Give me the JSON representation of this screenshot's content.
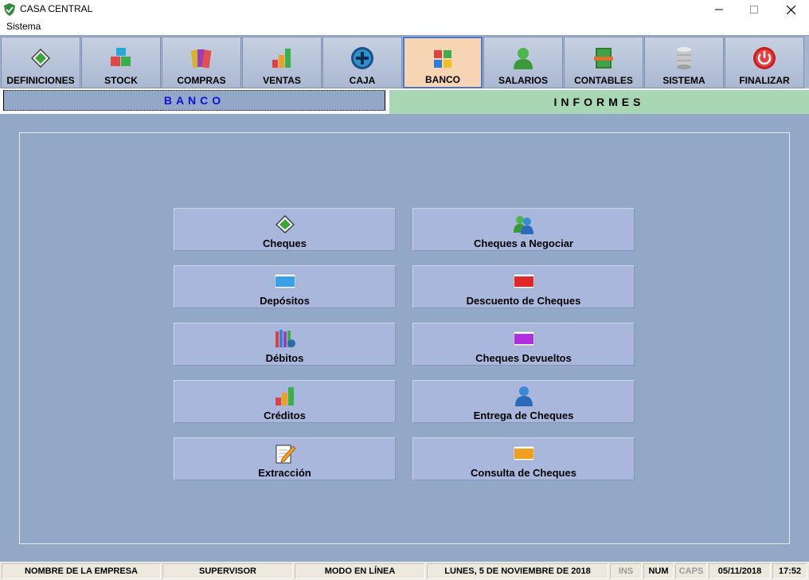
{
  "window": {
    "title": "CASA CENTRAL",
    "controls": {
      "minimize": "—",
      "maximize": "☐",
      "close": "✕"
    }
  },
  "menu": {
    "items": [
      "Sistema"
    ]
  },
  "toolbar": {
    "buttons": [
      {
        "label": "DEFINICIONES",
        "icon": "book-icon"
      },
      {
        "label": "STOCK",
        "icon": "boxes-icon"
      },
      {
        "label": "COMPRAS",
        "icon": "folders-icon"
      },
      {
        "label": "VENTAS",
        "icon": "bar-chart-icon"
      },
      {
        "label": "CAJA",
        "icon": "plus-circle-icon"
      },
      {
        "label": "BANCO",
        "icon": "windows-tiles-icon",
        "active": true
      },
      {
        "label": "SALARIOS",
        "icon": "user-icon"
      },
      {
        "label": "CONTABLES",
        "icon": "ledger-icon"
      },
      {
        "label": "SISTEMA",
        "icon": "database-icon"
      },
      {
        "label": "FINALIZAR",
        "icon": "power-icon"
      }
    ]
  },
  "tabs": {
    "banco": "BANCO",
    "informes": "INFORMES"
  },
  "functions": {
    "left": [
      {
        "label": "Cheques",
        "icon": "book-icon"
      },
      {
        "label": "Depósitos",
        "icon": "blue-card-icon"
      },
      {
        "label": "Débitos",
        "icon": "books-icon"
      },
      {
        "label": "Créditos",
        "icon": "bar-chart-icon"
      },
      {
        "label": "Extracción",
        "icon": "pencil-note-icon"
      }
    ],
    "right": [
      {
        "label": "Cheques a Negociar",
        "icon": "users-icon"
      },
      {
        "label": "Descuento de Cheques",
        "icon": "red-card-icon"
      },
      {
        "label": "Cheques Devueltos",
        "icon": "purple-card-icon"
      },
      {
        "label": "Entrega de Cheques",
        "icon": "user-blue-icon"
      },
      {
        "label": "Consulta de Cheques",
        "icon": "orange-card-icon"
      }
    ]
  },
  "status": {
    "company": "NOMBRE DE LA EMPRESA",
    "user": "SUPERVISOR",
    "mode": "MODO EN LÍNEA",
    "long_date": "LUNES, 5 DE NOVIEMBRE DE 2018",
    "ins": "INS",
    "num": "NUM",
    "caps": "CAPS",
    "date": "05/11/2018",
    "time": "17:52"
  },
  "colors": {
    "main_bg": "#93a7c6",
    "toolbar_bg": "#a5b4cf",
    "active_tab": "#f6d4b4",
    "banco_text": "#1010e0",
    "informes_tab": "#a8d7b4"
  }
}
